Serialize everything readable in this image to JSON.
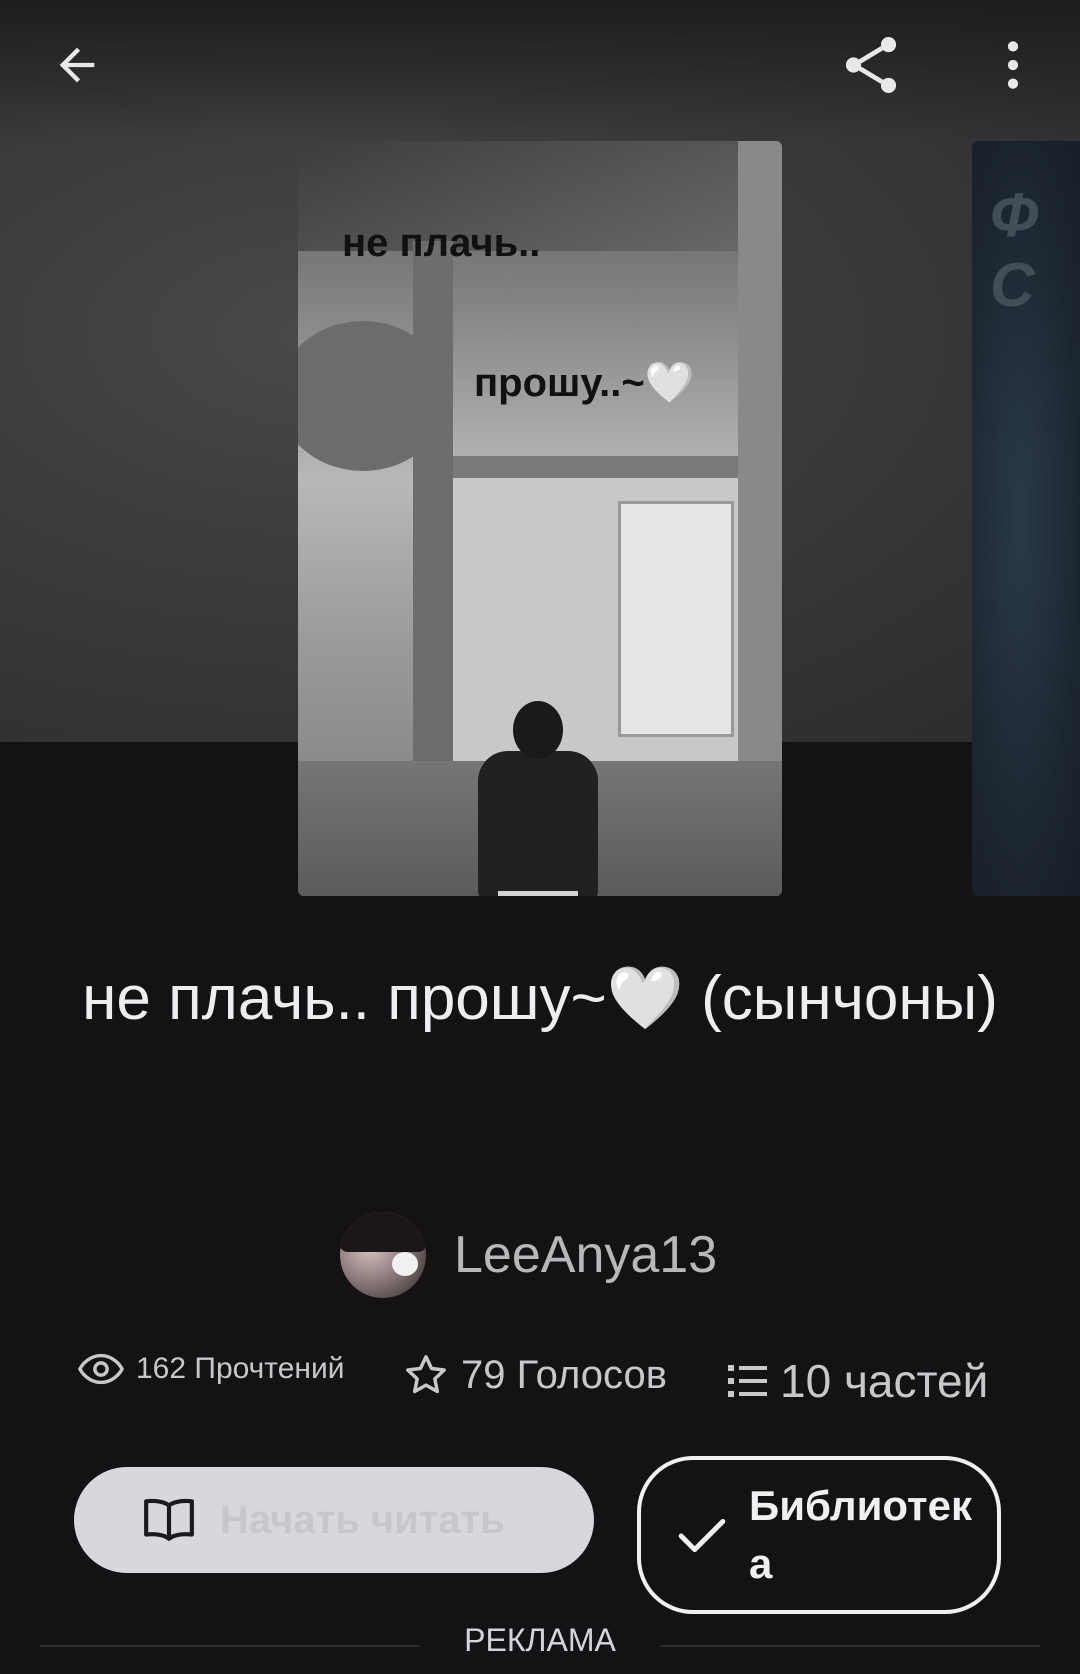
{
  "story": {
    "title": "не плачь.. прошу~🤍 (сынчоны)",
    "author": "LeeAnya13",
    "cover_caption_1": "не плачь..",
    "cover_caption_2": "прошу..~🤍",
    "next_cover_caption": "Ф\nС"
  },
  "stats": {
    "reads": "162 Прочтений",
    "votes": "79 Голосов",
    "parts": "10 частей"
  },
  "actions": {
    "read_label": "Начать читать",
    "library_label": "Библиотека"
  },
  "ad": {
    "label": "РЕКЛАМА"
  },
  "icons": {
    "back": "arrow-left-icon",
    "share": "share-icon",
    "more": "more-vertical-icon",
    "reads": "eye-icon",
    "votes": "star-icon",
    "parts": "list-icon",
    "read": "book-open-icon",
    "library": "check-icon"
  },
  "colors": {
    "background": "#141215",
    "read_button": "#d9d7dc",
    "text": "#efedf0"
  }
}
